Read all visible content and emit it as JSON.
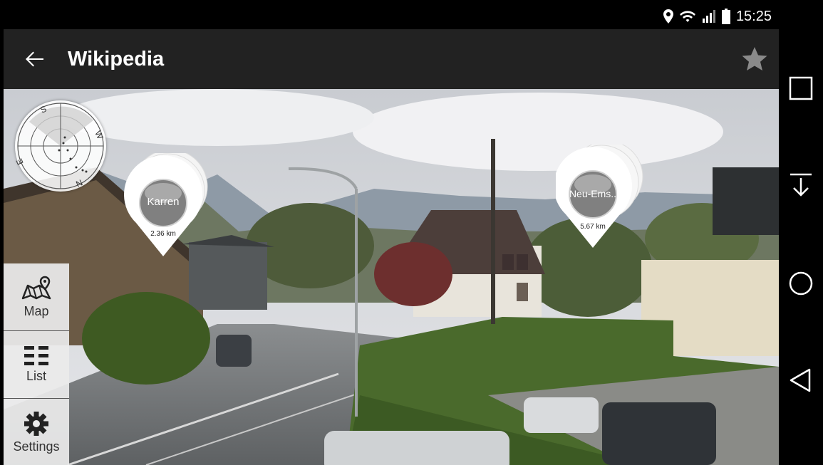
{
  "status_bar": {
    "time": "15:25",
    "icons": [
      "location-icon",
      "wifi-icon",
      "signal-icon",
      "battery-icon"
    ]
  },
  "app_bar": {
    "title": "Wikipedia",
    "back_icon": "arrow-left-icon",
    "favorite_icon": "star-icon"
  },
  "radar": {
    "labels": {
      "north": "N",
      "south": "S",
      "east": "E",
      "west": "W"
    }
  },
  "pois": [
    {
      "label": "Karren",
      "distance": "2.36 km"
    },
    {
      "label": "Neu-Ems..",
      "distance": "5.67 km"
    }
  ],
  "side_menu": {
    "items": [
      {
        "label": "Map",
        "icon": "map-icon"
      },
      {
        "label": "List",
        "icon": "list-icon"
      },
      {
        "label": "Settings",
        "icon": "gear-icon"
      }
    ]
  },
  "nav_bar": {
    "buttons": [
      "recents-square-icon",
      "download-arrow-icon",
      "home-circle-icon",
      "back-triangle-icon"
    ]
  },
  "colors": {
    "app_bar": "#222222",
    "status_bar": "#000000",
    "side_menu_bg": "#ebebeb",
    "poi_bubble": "#808080"
  }
}
